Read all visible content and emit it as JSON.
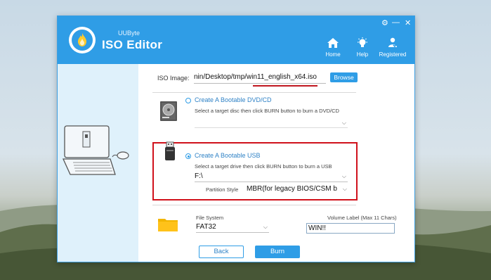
{
  "app": {
    "brand_small": "UUByte",
    "brand_big": "ISO Editor",
    "colors": {
      "accent": "#2f9de6",
      "highlight": "#d0111b"
    }
  },
  "window_controls": {
    "settings": "⚙",
    "minimize": "—",
    "close": "✕"
  },
  "nav": [
    {
      "label": "Home",
      "icon": "home-icon"
    },
    {
      "label": "Help",
      "icon": "help-icon"
    },
    {
      "label": "Registered",
      "icon": "registered-icon"
    }
  ],
  "iso": {
    "label": "ISO Image:",
    "path": "nin/Desktop/tmp/win11_english_x64.iso",
    "browse": "Browse"
  },
  "dvd": {
    "title": "Create A Bootable DVD/CD",
    "desc": "Select a target disc then click BURN button to burn a DVD/CD",
    "selected": false
  },
  "usb": {
    "title": "Create A Bootable USB",
    "desc": "Select a target drive then click BURN button to burn a USB",
    "drive": "F:\\",
    "selected": true,
    "partition_label": "Partition Style",
    "partition_value": "MBR(for legacy BIOS/CSM b"
  },
  "fs": {
    "label": "File System",
    "value": "FAT32",
    "volume_label": "Volume Label (Max 11 Chars)",
    "volume_value": "WIN!!"
  },
  "buttons": {
    "back": "Back",
    "burn": "Burn"
  }
}
